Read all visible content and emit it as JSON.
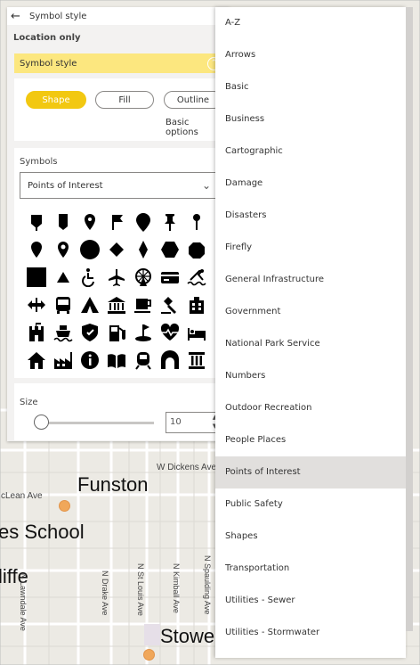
{
  "panel": {
    "title": "Symbol style",
    "location_label": "Location only",
    "section_label": "Symbol style",
    "shape_tabs": [
      "Shape",
      "Fill",
      "Outline"
    ],
    "basic_options": "Basic options",
    "symbols_label": "Symbols",
    "symbols_dropdown_value": "Points of Interest",
    "size_label": "Size",
    "size_value": "10",
    "size_slider_fraction": 0.05
  },
  "symbols": [
    "map-pin-icon",
    "bookmark-pin-icon",
    "location-pin-icon",
    "flag-icon",
    "balloon-pin-icon",
    "pushpin-icon",
    "needle-pin-icon",
    "map-marker-icon",
    "location-outline-icon",
    "circle-icon",
    "diamond-icon",
    "rhombus-icon",
    "hexagon-icon",
    "octagon-icon",
    "square-icon",
    "triangle-icon",
    "wheelchair-icon",
    "airplane-icon",
    "ferris-wheel-icon",
    "credit-card-icon",
    "pool-icon",
    "double-arrow-icon",
    "bus-icon",
    "tent-icon",
    "museum-icon",
    "coffee-icon",
    "gavel-icon",
    "hotel-building-icon",
    "castle-icon",
    "ferry-icon",
    "shield-icon",
    "gas-pump-icon",
    "golf-icon",
    "heart-rate-icon",
    "bed-icon",
    "house-icon",
    "factory-icon",
    "info-icon",
    "book-icon",
    "train-icon",
    "tunnel-icon",
    "pillar-icon"
  ],
  "list_items": [
    "A-Z",
    "Arrows",
    "Basic",
    "Business",
    "Cartographic",
    "Damage",
    "Disasters",
    "Firefly",
    "General Infrastructure",
    "Government",
    "National Park Service",
    "Numbers",
    "Outdoor Recreation",
    "People Places",
    "Points of Interest",
    "Public Safety",
    "Shapes",
    "Transportation",
    "Utilities - Sewer",
    "Utilities - Stormwater"
  ],
  "selected_item": "Points of Interest",
  "map": {
    "places": [
      "Funston",
      "es School",
      "liffe",
      "Stowe"
    ],
    "streets": [
      "W Dickens Ave",
      "cLean Ave",
      "N Lawndale Ave",
      "N Drake Ave",
      "N St Louis Ave",
      "N Kimball Ave",
      "N Spaulding Ave"
    ]
  },
  "colors": {
    "accent": "#f2c811",
    "section": "#fce77f",
    "selected": "#e1dfdd",
    "poi": "#f0a75a"
  }
}
